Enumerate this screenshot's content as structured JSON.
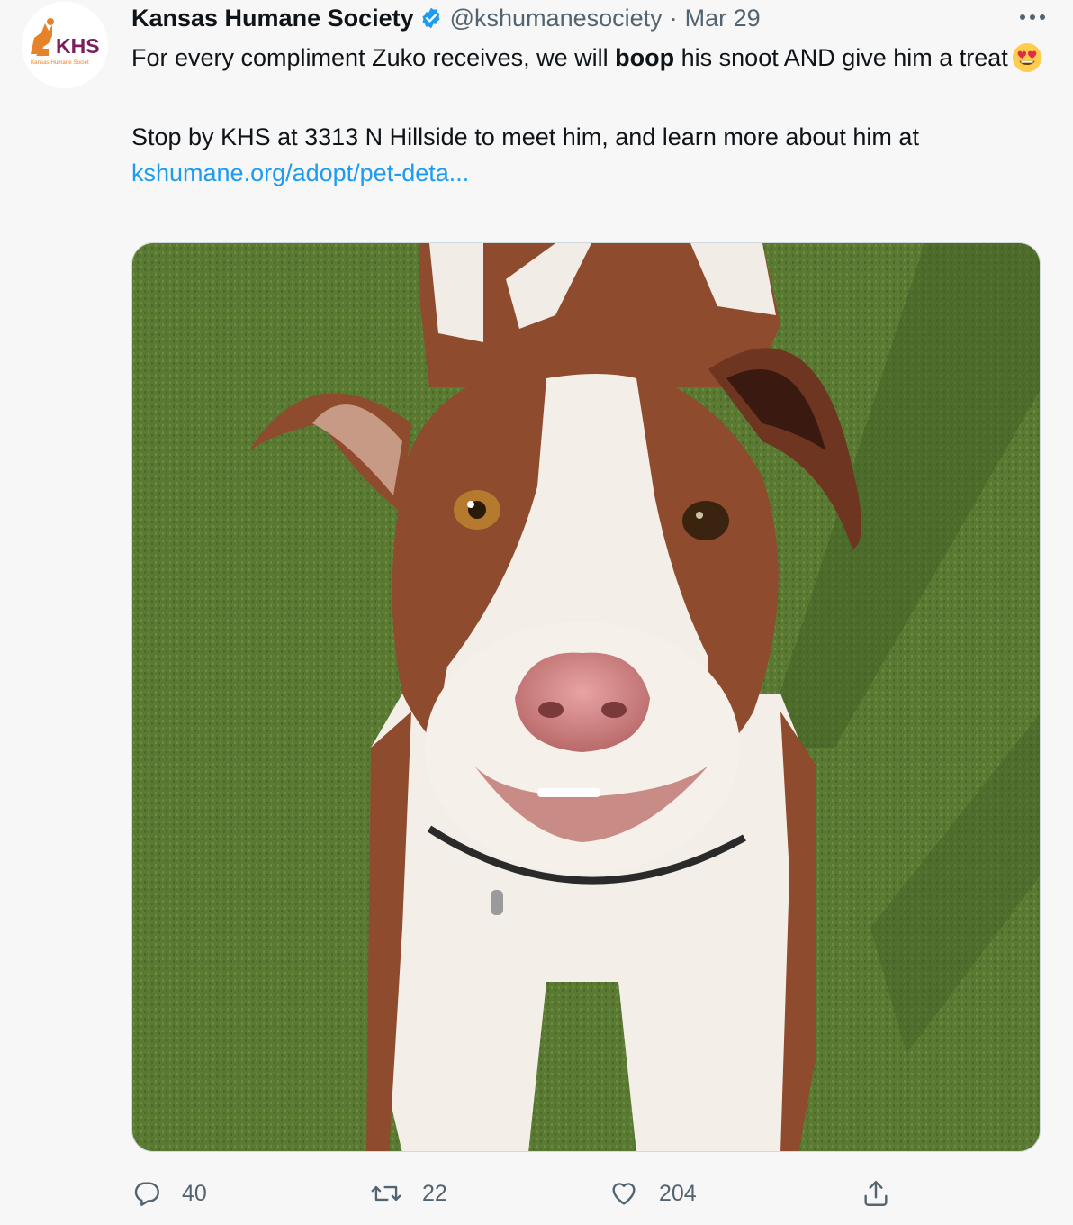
{
  "tweet": {
    "author": {
      "display_name": "Kansas Humane Society",
      "handle": "@kshumanesociety",
      "verified": true,
      "avatar_icon": "khs-logo",
      "logo_text": "KHS",
      "logo_subtext": "Kansas Humane Societ"
    },
    "separator": "·",
    "date": "Mar 29",
    "more_icon": "more-horizontal-icon",
    "text": {
      "line1_before_bold": "For every compliment Zuko receives, we will ",
      "bold_word": "boop",
      "line1_after_bold": " his snoot AND give him a treat",
      "emoji": "smiling-face-with-heart-eyes",
      "paragraph2": "Stop by KHS at 3313 N Hillside to meet him, and learn more about him at",
      "link_text": "kshumane.org/adopt/pet-deta..."
    },
    "media": {
      "type": "photo",
      "subject": "brown-and-white-dog-on-grass"
    },
    "actions": {
      "reply": {
        "icon": "reply-icon",
        "count": "40"
      },
      "retweet": {
        "icon": "retweet-icon",
        "count": "22"
      },
      "like": {
        "icon": "heart-icon",
        "count": "204"
      },
      "share": {
        "icon": "share-icon"
      }
    },
    "colors": {
      "link": "#1d9bf0",
      "verified": "#1d9bf0",
      "secondary_text": "#536471",
      "background": "#f7f7f7",
      "logo_orange": "#e5822a",
      "logo_purple": "#7a1f5c"
    }
  }
}
